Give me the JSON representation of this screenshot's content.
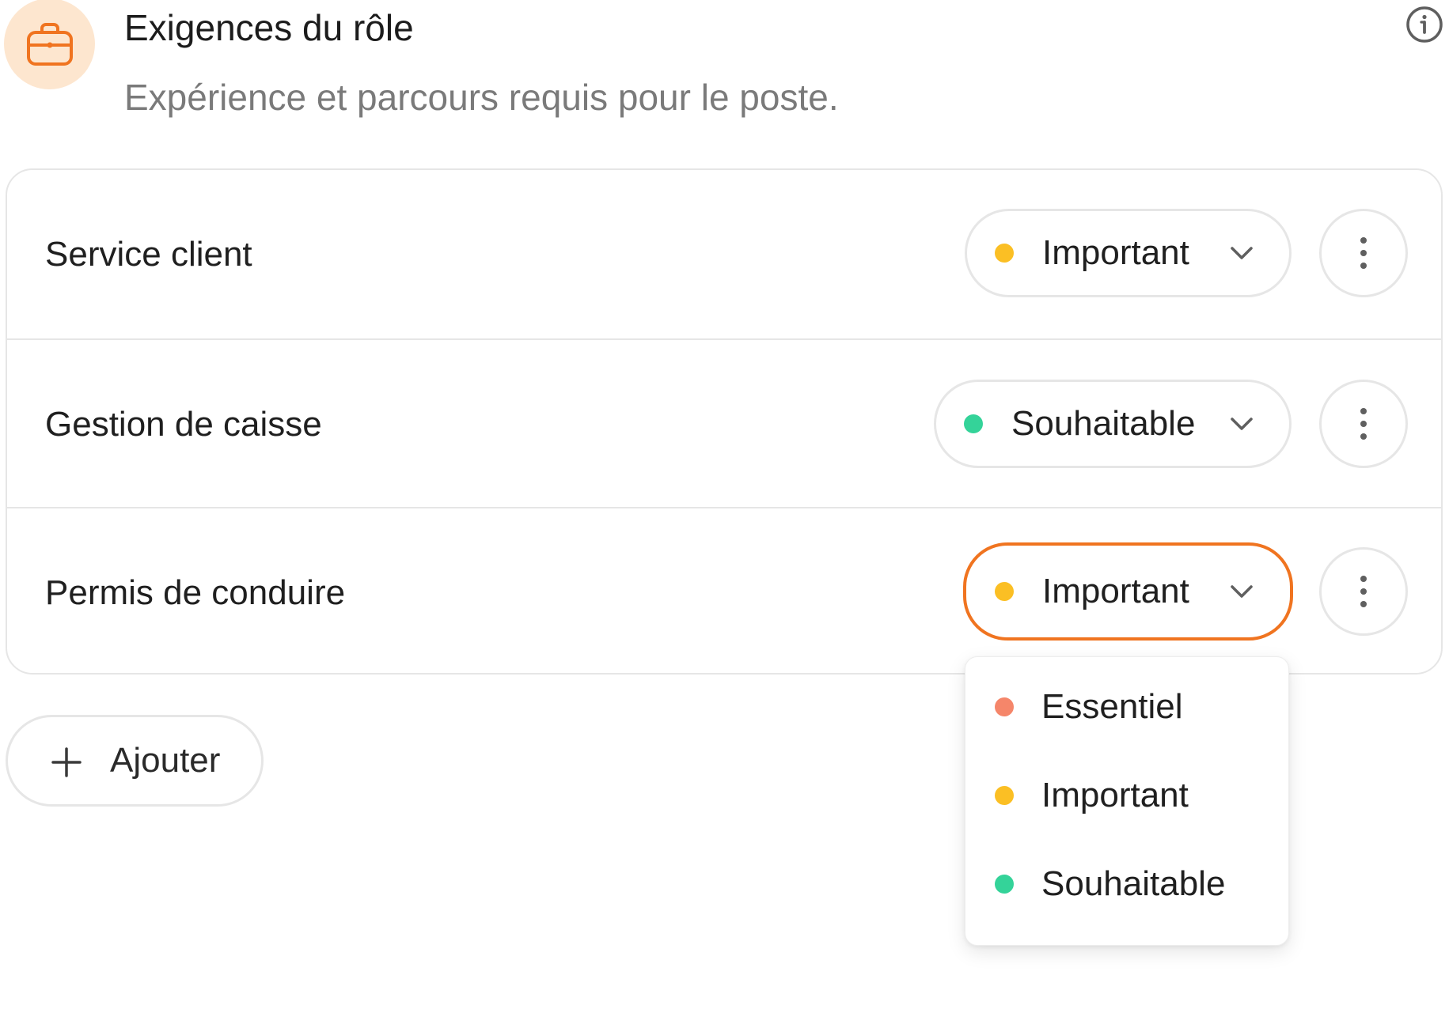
{
  "header": {
    "icon": "briefcase-icon",
    "title": "Exigences du rôle",
    "subtitle": "Expérience et parcours requis pour le poste.",
    "info_icon": "info-icon"
  },
  "colors": {
    "accent": "#f07420",
    "essentiel": "#f5866a",
    "important": "#fbbf24",
    "souhaitable": "#34d399",
    "icon_bg": "#fde6cf"
  },
  "requirements": [
    {
      "label": "Service client",
      "priority": "Important"
    },
    {
      "label": "Gestion de caisse",
      "priority": "Souhaitable"
    },
    {
      "label": "Permis de conduire",
      "priority": "Important"
    }
  ],
  "add_button": {
    "label": "Ajouter",
    "icon": "plus-icon"
  },
  "dropdown": {
    "options": [
      {
        "label": "Essentiel"
      },
      {
        "label": "Important"
      },
      {
        "label": "Souhaitable"
      }
    ]
  }
}
